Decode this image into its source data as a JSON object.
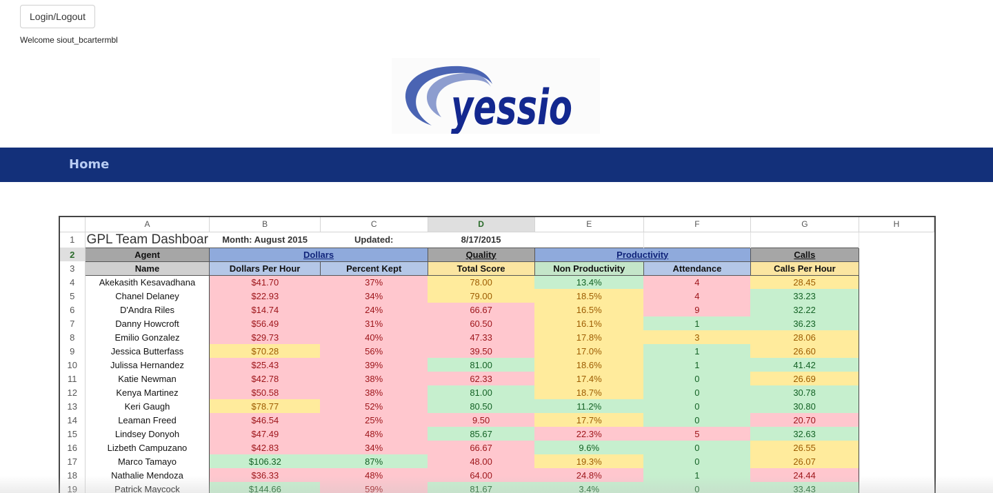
{
  "auth": {
    "login_label": "Login/Logout",
    "welcome_text": "Welcome siout_bcartermbl"
  },
  "logo": {
    "text": "yessio",
    "brand_color": "#13288f",
    "swoosh_color": "#4a64b3"
  },
  "nav": {
    "home_label": "Home",
    "bar_color": "#13307a"
  },
  "sheet": {
    "columns": [
      "A",
      "B",
      "C",
      "D",
      "E",
      "F",
      "G",
      "H"
    ],
    "selected_column": "D",
    "selected_row": "2",
    "title": "GPL Team Dashboar",
    "month": "Month: August 2015",
    "updated_label": "Updated:",
    "updated_date": "8/17/2015",
    "groups": {
      "agent": "Agent",
      "dollars": "Dollars",
      "quality": "Quality",
      "productivity": "Productivity",
      "calls": "Calls"
    },
    "headers": {
      "name": "Name",
      "dph": "Dollars Per Hour",
      "pk": "Percent Kept",
      "ts": "Total Score",
      "np": "Non Productivity",
      "att": "Attendance",
      "cph": "Calls Per Hour"
    },
    "rows": [
      {
        "num": "4",
        "name": "Akekasith Kesavadhana",
        "dph": "$41.70",
        "dph_c": "red",
        "pk": "37%",
        "pk_c": "red",
        "ts": "78.00",
        "ts_c": "yel",
        "np": "13.4%",
        "np_c": "grn",
        "att": "4",
        "att_c": "red",
        "cph": "28.45",
        "cph_c": "yel"
      },
      {
        "num": "5",
        "name": "Chanel Delaney",
        "dph": "$22.93",
        "dph_c": "red",
        "pk": "34%",
        "pk_c": "red",
        "ts": "79.00",
        "ts_c": "yel",
        "np": "18.5%",
        "np_c": "yel",
        "att": "4",
        "att_c": "red",
        "cph": "33.23",
        "cph_c": "grn"
      },
      {
        "num": "6",
        "name": "D'Andra Riles",
        "dph": "$14.74",
        "dph_c": "red",
        "pk": "24%",
        "pk_c": "red",
        "ts": "66.67",
        "ts_c": "red",
        "np": "16.5%",
        "np_c": "yel",
        "att": "9",
        "att_c": "red",
        "cph": "32.22",
        "cph_c": "grn"
      },
      {
        "num": "7",
        "name": "Danny Howcroft",
        "dph": "$56.49",
        "dph_c": "red",
        "pk": "31%",
        "pk_c": "red",
        "ts": "60.50",
        "ts_c": "red",
        "np": "16.1%",
        "np_c": "yel",
        "att": "1",
        "att_c": "grn",
        "cph": "36.23",
        "cph_c": "grn"
      },
      {
        "num": "8",
        "name": "Emilio Gonzalez",
        "dph": "$29.73",
        "dph_c": "red",
        "pk": "40%",
        "pk_c": "red",
        "ts": "47.33",
        "ts_c": "red",
        "np": "17.8%",
        "np_c": "yel",
        "att": "3",
        "att_c": "yel",
        "cph": "28.06",
        "cph_c": "yel"
      },
      {
        "num": "9",
        "name": "Jessica Butterfass",
        "dph": "$70.28",
        "dph_c": "yel",
        "pk": "56%",
        "pk_c": "red",
        "ts": "39.50",
        "ts_c": "red",
        "np": "17.0%",
        "np_c": "yel",
        "att": "1",
        "att_c": "grn",
        "cph": "26.60",
        "cph_c": "yel"
      },
      {
        "num": "10",
        "name": "Julissa Hernandez",
        "dph": "$25.43",
        "dph_c": "red",
        "pk": "39%",
        "pk_c": "red",
        "ts": "81.00",
        "ts_c": "grn",
        "np": "18.6%",
        "np_c": "yel",
        "att": "1",
        "att_c": "grn",
        "cph": "41.42",
        "cph_c": "grn"
      },
      {
        "num": "11",
        "name": "Katie Newman",
        "dph": "$42.78",
        "dph_c": "red",
        "pk": "38%",
        "pk_c": "red",
        "ts": "62.33",
        "ts_c": "red",
        "np": "17.4%",
        "np_c": "yel",
        "att": "0",
        "att_c": "grn",
        "cph": "26.69",
        "cph_c": "yel"
      },
      {
        "num": "12",
        "name": "Kenya Martinez",
        "dph": "$50.58",
        "dph_c": "red",
        "pk": "38%",
        "pk_c": "red",
        "ts": "81.00",
        "ts_c": "grn",
        "np": "18.7%",
        "np_c": "yel",
        "att": "0",
        "att_c": "grn",
        "cph": "30.78",
        "cph_c": "grn"
      },
      {
        "num": "13",
        "name": "Keri Gaugh",
        "dph": "$78.77",
        "dph_c": "yel",
        "pk": "52%",
        "pk_c": "red",
        "ts": "80.50",
        "ts_c": "grn",
        "np": "11.2%",
        "np_c": "grn",
        "att": "0",
        "att_c": "grn",
        "cph": "30.80",
        "cph_c": "grn"
      },
      {
        "num": "14",
        "name": "Leaman Freed",
        "dph": "$46.54",
        "dph_c": "red",
        "pk": "25%",
        "pk_c": "red",
        "ts": "9.50",
        "ts_c": "red",
        "np": "17.7%",
        "np_c": "yel",
        "att": "0",
        "att_c": "grn",
        "cph": "20.70",
        "cph_c": "red"
      },
      {
        "num": "15",
        "name": "Lindsey Donyoh",
        "dph": "$47.49",
        "dph_c": "red",
        "pk": "48%",
        "pk_c": "red",
        "ts": "85.67",
        "ts_c": "grn",
        "np": "22.3%",
        "np_c": "red",
        "att": "5",
        "att_c": "red",
        "cph": "32.63",
        "cph_c": "grn"
      },
      {
        "num": "16",
        "name": "Lizbeth Campuzano",
        "dph": "$42.83",
        "dph_c": "red",
        "pk": "34%",
        "pk_c": "red",
        "ts": "66.67",
        "ts_c": "red",
        "np": "9.6%",
        "np_c": "grn",
        "att": "0",
        "att_c": "grn",
        "cph": "26.55",
        "cph_c": "yel"
      },
      {
        "num": "17",
        "name": "Marco Tamayo",
        "dph": "$106.32",
        "dph_c": "grn",
        "pk": "87%",
        "pk_c": "grn",
        "ts": "48.00",
        "ts_c": "red",
        "np": "19.3%",
        "np_c": "yel",
        "att": "0",
        "att_c": "grn",
        "cph": "26.07",
        "cph_c": "yel"
      },
      {
        "num": "18",
        "name": "Nathalie Mendoza",
        "dph": "$36.33",
        "dph_c": "red",
        "pk": "48%",
        "pk_c": "red",
        "ts": "64.00",
        "ts_c": "red",
        "np": "24.8%",
        "np_c": "red",
        "att": "1",
        "att_c": "grn",
        "cph": "24.44",
        "cph_c": "red"
      },
      {
        "num": "19",
        "name": "Patrick Maycock",
        "dph": "$144.66",
        "dph_c": "grn",
        "pk": "59%",
        "pk_c": "red",
        "ts": "81.67",
        "ts_c": "grn",
        "np": "3.4%",
        "np_c": "grn",
        "att": "0",
        "att_c": "grn",
        "cph": "33.43",
        "cph_c": "grn"
      }
    ]
  }
}
